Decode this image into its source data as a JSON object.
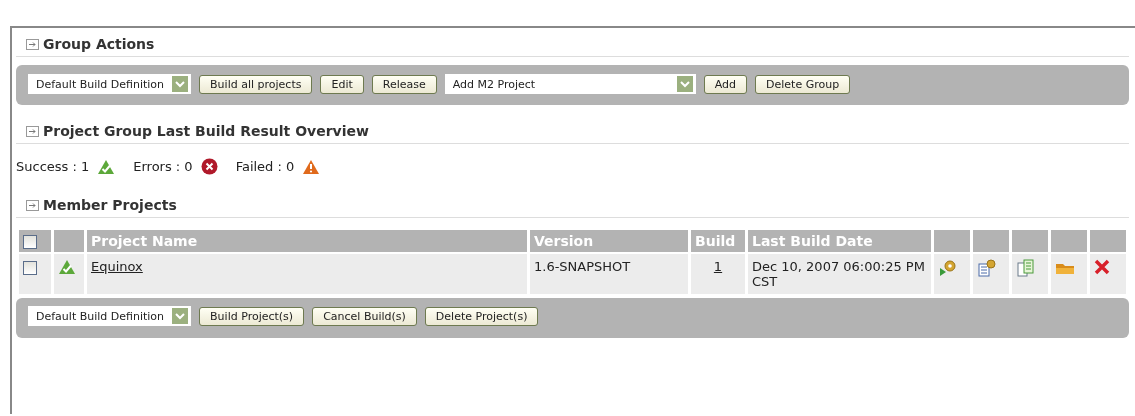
{
  "group_actions": {
    "title": "Group Actions",
    "build_definition": "Default Build Definition",
    "buttons": [
      "Build all projects",
      "Edit",
      "Release"
    ],
    "add_select": "Add M2 Project",
    "add_buttons": [
      "Add",
      "Delete Group"
    ]
  },
  "overview": {
    "title": "Project Group Last Build Result Overview",
    "counts": [
      {
        "kind": "success",
        "label": "Success : 1"
      },
      {
        "kind": "error",
        "label": "Errors : 0"
      },
      {
        "kind": "failed",
        "label": "Failed : 0"
      }
    ]
  },
  "members": {
    "title": "Member Projects",
    "columns": [
      "Project Name",
      "Version",
      "Build",
      "Last Build Date"
    ],
    "select_all_checked": false,
    "rows": [
      {
        "checked": false,
        "kind": "success",
        "name": "Equinox",
        "version": "1.6-SNAPSHOT",
        "build": "1",
        "date": "Dec 10, 2007 06:00:25 PM CST"
      }
    ],
    "build_definition": "Default Build Definition",
    "buttons": [
      "Build Project(s)",
      "Cancel Build(s)",
      "Delete Project(s)"
    ]
  }
}
